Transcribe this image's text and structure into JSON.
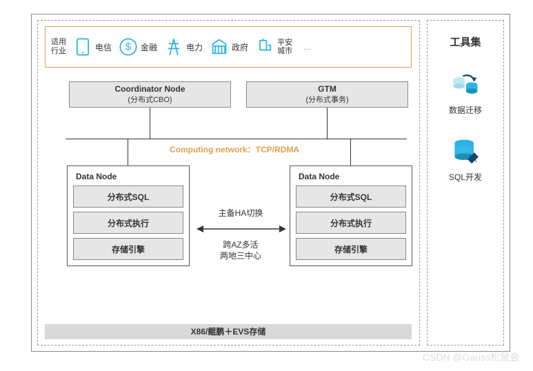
{
  "industry": {
    "header": "适用\n行业",
    "items": [
      {
        "icon": "tablet-icon",
        "label": "电信"
      },
      {
        "icon": "dollar-icon",
        "label": "金融"
      },
      {
        "icon": "pylon-icon",
        "label": "电力"
      },
      {
        "icon": "government-icon",
        "label": "政府"
      },
      {
        "icon": "city-icon",
        "label": "平安\n城市"
      }
    ],
    "more": "…"
  },
  "top_nodes": {
    "coordinator": {
      "title": "Coordinator Node",
      "sub": "(分布式CBO)"
    },
    "gtm": {
      "title": "GTM",
      "sub": "(分布式事务)"
    }
  },
  "network": "Computing network：TCP/RDMA",
  "data_node": {
    "title": "Data Node",
    "boxes": [
      "分布式SQL",
      "分布式执行",
      "存储引擎"
    ]
  },
  "middle": {
    "line1": "主备HA切换",
    "line2": "跨AZ多活",
    "line3": "两地三中心"
  },
  "footer": "X86/鲲鹏＋EVS存储",
  "toolkit": {
    "title": "工具集",
    "items": [
      {
        "icon": "migration-icon",
        "label": "数据迁移"
      },
      {
        "icon": "sqldev-icon",
        "label": "SQL开发"
      }
    ]
  },
  "watermark": "CSDN @Gauss松鼠会"
}
